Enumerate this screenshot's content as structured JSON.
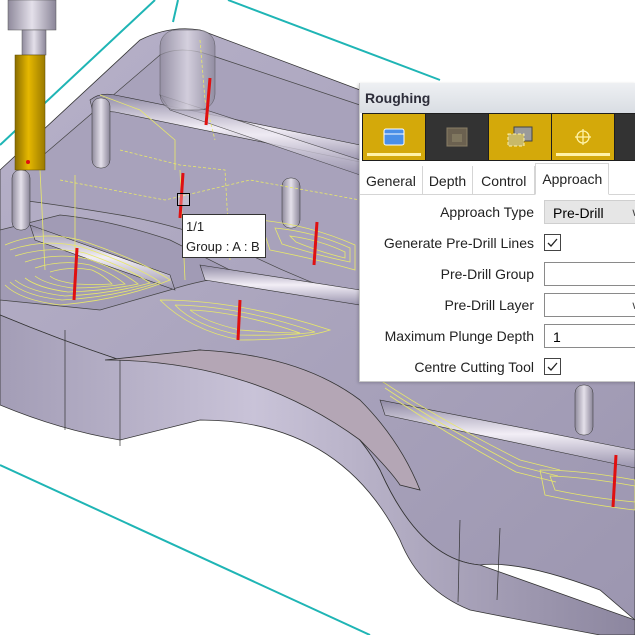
{
  "panel": {
    "title": "Roughing",
    "toolbar": [
      {
        "icon": "feature-box-icon",
        "state": "on",
        "underline": true
      },
      {
        "icon": "stock-box-icon",
        "state": "off",
        "underline": false
      },
      {
        "icon": "boundary-region-icon",
        "state": "on",
        "underline": false
      },
      {
        "icon": "crosshair-target-icon",
        "state": "on",
        "underline": true
      }
    ],
    "tabs": [
      "General",
      "Depth",
      "Control",
      "Approach"
    ],
    "active_tab": "Approach",
    "fields": {
      "approach_type": {
        "label": "Approach Type",
        "value": "Pre-Drill"
      },
      "generate_predrill": {
        "label": "Generate Pre-Drill Lines",
        "checked": true
      },
      "predrill_group": {
        "label": "Pre-Drill Group",
        "value": ""
      },
      "predrill_layer": {
        "label": "Pre-Drill Layer",
        "value": ""
      },
      "max_plunge": {
        "label": "Maximum Plunge Depth",
        "value": "1"
      },
      "centre_cutting": {
        "label": "Centre Cutting Tool",
        "checked": true
      }
    }
  },
  "tooltip": {
    "line1": "1/1",
    "line2": "Group : A : B"
  },
  "colors": {
    "accent": "#d4a90a",
    "toolpath": "#e8e86a",
    "plunge": "#e01010",
    "boundary": "#1fb5b5",
    "part": "#a9a3bd"
  }
}
